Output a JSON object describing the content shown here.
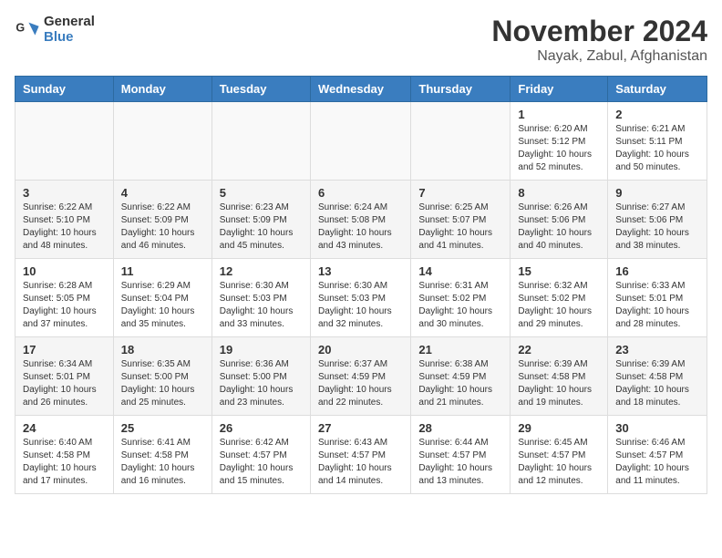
{
  "logo": {
    "text_general": "General",
    "text_blue": "Blue"
  },
  "header": {
    "month": "November 2024",
    "location": "Nayak, Zabul, Afghanistan"
  },
  "days_of_week": [
    "Sunday",
    "Monday",
    "Tuesday",
    "Wednesday",
    "Thursday",
    "Friday",
    "Saturday"
  ],
  "weeks": [
    [
      {
        "day": "",
        "info": ""
      },
      {
        "day": "",
        "info": ""
      },
      {
        "day": "",
        "info": ""
      },
      {
        "day": "",
        "info": ""
      },
      {
        "day": "",
        "info": ""
      },
      {
        "day": "1",
        "info": "Sunrise: 6:20 AM\nSunset: 5:12 PM\nDaylight: 10 hours\nand 52 minutes."
      },
      {
        "day": "2",
        "info": "Sunrise: 6:21 AM\nSunset: 5:11 PM\nDaylight: 10 hours\nand 50 minutes."
      }
    ],
    [
      {
        "day": "3",
        "info": "Sunrise: 6:22 AM\nSunset: 5:10 PM\nDaylight: 10 hours\nand 48 minutes."
      },
      {
        "day": "4",
        "info": "Sunrise: 6:22 AM\nSunset: 5:09 PM\nDaylight: 10 hours\nand 46 minutes."
      },
      {
        "day": "5",
        "info": "Sunrise: 6:23 AM\nSunset: 5:09 PM\nDaylight: 10 hours\nand 45 minutes."
      },
      {
        "day": "6",
        "info": "Sunrise: 6:24 AM\nSunset: 5:08 PM\nDaylight: 10 hours\nand 43 minutes."
      },
      {
        "day": "7",
        "info": "Sunrise: 6:25 AM\nSunset: 5:07 PM\nDaylight: 10 hours\nand 41 minutes."
      },
      {
        "day": "8",
        "info": "Sunrise: 6:26 AM\nSunset: 5:06 PM\nDaylight: 10 hours\nand 40 minutes."
      },
      {
        "day": "9",
        "info": "Sunrise: 6:27 AM\nSunset: 5:06 PM\nDaylight: 10 hours\nand 38 minutes."
      }
    ],
    [
      {
        "day": "10",
        "info": "Sunrise: 6:28 AM\nSunset: 5:05 PM\nDaylight: 10 hours\nand 37 minutes."
      },
      {
        "day": "11",
        "info": "Sunrise: 6:29 AM\nSunset: 5:04 PM\nDaylight: 10 hours\nand 35 minutes."
      },
      {
        "day": "12",
        "info": "Sunrise: 6:30 AM\nSunset: 5:03 PM\nDaylight: 10 hours\nand 33 minutes."
      },
      {
        "day": "13",
        "info": "Sunrise: 6:30 AM\nSunset: 5:03 PM\nDaylight: 10 hours\nand 32 minutes."
      },
      {
        "day": "14",
        "info": "Sunrise: 6:31 AM\nSunset: 5:02 PM\nDaylight: 10 hours\nand 30 minutes."
      },
      {
        "day": "15",
        "info": "Sunrise: 6:32 AM\nSunset: 5:02 PM\nDaylight: 10 hours\nand 29 minutes."
      },
      {
        "day": "16",
        "info": "Sunrise: 6:33 AM\nSunset: 5:01 PM\nDaylight: 10 hours\nand 28 minutes."
      }
    ],
    [
      {
        "day": "17",
        "info": "Sunrise: 6:34 AM\nSunset: 5:01 PM\nDaylight: 10 hours\nand 26 minutes."
      },
      {
        "day": "18",
        "info": "Sunrise: 6:35 AM\nSunset: 5:00 PM\nDaylight: 10 hours\nand 25 minutes."
      },
      {
        "day": "19",
        "info": "Sunrise: 6:36 AM\nSunset: 5:00 PM\nDaylight: 10 hours\nand 23 minutes."
      },
      {
        "day": "20",
        "info": "Sunrise: 6:37 AM\nSunset: 4:59 PM\nDaylight: 10 hours\nand 22 minutes."
      },
      {
        "day": "21",
        "info": "Sunrise: 6:38 AM\nSunset: 4:59 PM\nDaylight: 10 hours\nand 21 minutes."
      },
      {
        "day": "22",
        "info": "Sunrise: 6:39 AM\nSunset: 4:58 PM\nDaylight: 10 hours\nand 19 minutes."
      },
      {
        "day": "23",
        "info": "Sunrise: 6:39 AM\nSunset: 4:58 PM\nDaylight: 10 hours\nand 18 minutes."
      }
    ],
    [
      {
        "day": "24",
        "info": "Sunrise: 6:40 AM\nSunset: 4:58 PM\nDaylight: 10 hours\nand 17 minutes."
      },
      {
        "day": "25",
        "info": "Sunrise: 6:41 AM\nSunset: 4:58 PM\nDaylight: 10 hours\nand 16 minutes."
      },
      {
        "day": "26",
        "info": "Sunrise: 6:42 AM\nSunset: 4:57 PM\nDaylight: 10 hours\nand 15 minutes."
      },
      {
        "day": "27",
        "info": "Sunrise: 6:43 AM\nSunset: 4:57 PM\nDaylight: 10 hours\nand 14 minutes."
      },
      {
        "day": "28",
        "info": "Sunrise: 6:44 AM\nSunset: 4:57 PM\nDaylight: 10 hours\nand 13 minutes."
      },
      {
        "day": "29",
        "info": "Sunrise: 6:45 AM\nSunset: 4:57 PM\nDaylight: 10 hours\nand 12 minutes."
      },
      {
        "day": "30",
        "info": "Sunrise: 6:46 AM\nSunset: 4:57 PM\nDaylight: 10 hours\nand 11 minutes."
      }
    ]
  ]
}
